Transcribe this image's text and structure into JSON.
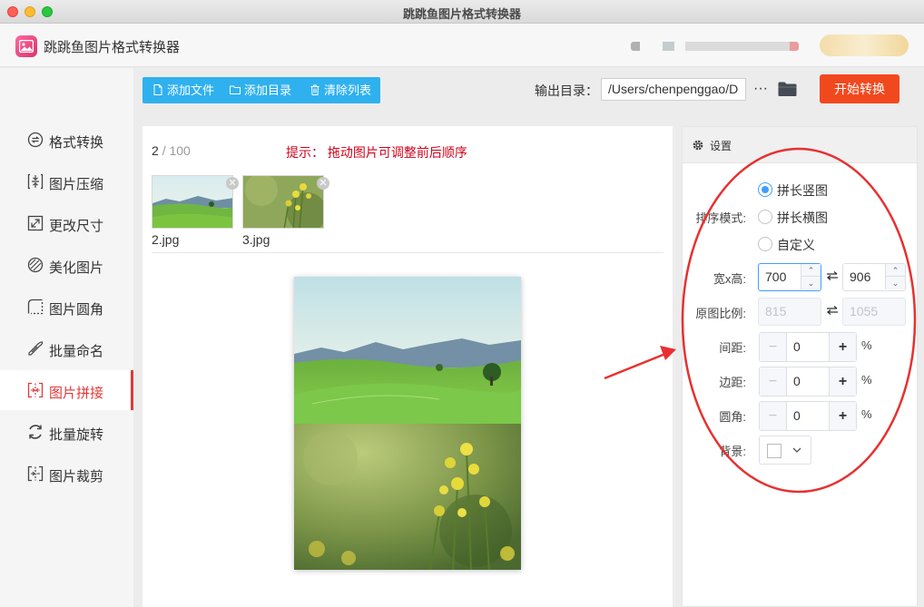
{
  "window": {
    "title": "跳跳鱼图片格式转换器"
  },
  "app": {
    "name": "跳跳鱼图片格式转换器"
  },
  "sidebar": {
    "items": [
      {
        "label": "格式转换",
        "icon": "format-convert-icon"
      },
      {
        "label": "图片压缩",
        "icon": "compress-icon"
      },
      {
        "label": "更改尺寸",
        "icon": "resize-icon"
      },
      {
        "label": "美化图片",
        "icon": "beautify-icon"
      },
      {
        "label": "图片圆角",
        "icon": "round-corner-icon"
      },
      {
        "label": "批量命名",
        "icon": "rename-icon"
      },
      {
        "label": "图片拼接",
        "icon": "stitch-icon",
        "active": true
      },
      {
        "label": "批量旋转",
        "icon": "rotate-icon"
      },
      {
        "label": "图片裁剪",
        "icon": "crop-icon"
      }
    ]
  },
  "toolbar": {
    "add_file": "添加文件",
    "add_folder": "添加目录",
    "clear_list": "清除列表"
  },
  "output": {
    "label": "输出目录：",
    "path": "/Users/chenpenggao/D",
    "more": "···"
  },
  "start_button": "开始转换",
  "list": {
    "current": "2",
    "total": "/ 100",
    "hint": "提示：  拖动图片可调整前后顺序",
    "files": [
      {
        "name": "2.jpg"
      },
      {
        "name": "3.jpg"
      }
    ]
  },
  "settings": {
    "title": "设置",
    "order_label": "排序模式:",
    "order_options": [
      "拼长竖图",
      "拼长横图",
      "自定义"
    ],
    "selected_order": "拼长竖图",
    "size_label": "宽x高:",
    "width": "700",
    "height": "906",
    "ratio_label": "原图比例:",
    "ratio_width": "815",
    "ratio_height": "1055",
    "spacing_label": "间距:",
    "spacing": "0",
    "margin_label": "边距:",
    "margin": "0",
    "radius_label": "圆角:",
    "radius": "0",
    "unit": "%",
    "bg_label": "背景:",
    "bg_color": "#ffffff"
  },
  "colors": {
    "accent": "#e0393a",
    "toolbar_blue": "#2fb1ef",
    "start_orange": "#f2481e",
    "radio_blue": "#409eff",
    "annotation_red": "#e83030"
  }
}
